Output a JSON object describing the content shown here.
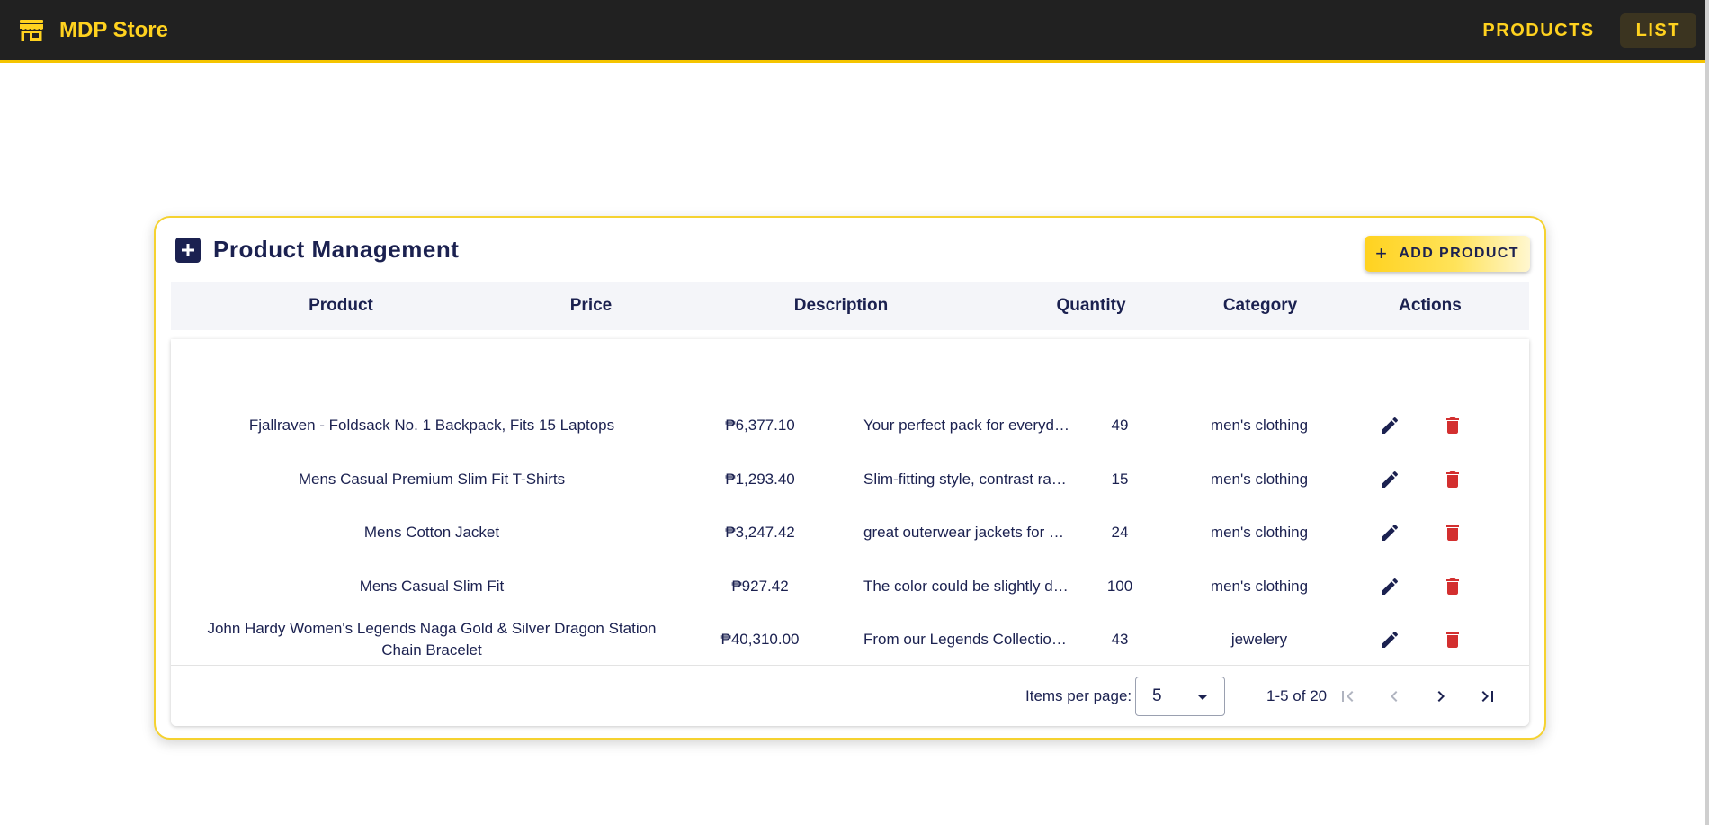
{
  "app": {
    "name": "MDP Store",
    "nav": [
      {
        "label": "PRODUCTS",
        "active": false
      },
      {
        "label": "LIST",
        "active": true
      }
    ]
  },
  "panel": {
    "title": "Product Management",
    "add_button": "ADD PRODUCT"
  },
  "table": {
    "columns": [
      "Product",
      "Price",
      "Description",
      "Quantity",
      "Category",
      "Actions"
    ],
    "rows": [
      {
        "product": "Fjallraven - Foldsack No. 1 Backpack, Fits 15 Laptops",
        "price": "₱6,377.10",
        "description": "Your perfect pack for everyday u...",
        "quantity": "49",
        "category": "men's clothing"
      },
      {
        "product": "Mens Casual Premium Slim Fit T-Shirts",
        "price": "₱1,293.40",
        "description": "Slim-fitting style, contrast raglan...",
        "quantity": "15",
        "category": "men's clothing"
      },
      {
        "product": "Mens Cotton Jacket",
        "price": "₱3,247.42",
        "description": "great outerwear jackets for Spri...",
        "quantity": "24",
        "category": "men's clothing"
      },
      {
        "product": "Mens Casual Slim Fit",
        "price": "₱927.42",
        "description": "The color could be slightly differ...",
        "quantity": "100",
        "category": "men's clothing"
      },
      {
        "product": "John Hardy Women's Legends Naga Gold & Silver Dragon Station Chain Bracelet",
        "price": "₱40,310.00",
        "description": "From our Legends Collection, th...",
        "quantity": "43",
        "category": "jewelery"
      }
    ]
  },
  "paginator": {
    "items_per_page_label": "Items per page:",
    "items_per_page": "5",
    "range": "1-5 of 20"
  },
  "colors": {
    "accent": "#ffd21f",
    "navy": "#1b2150",
    "delete": "#d32f2f",
    "topbar": "#212121"
  },
  "icons": {
    "brand": "storefront-icon",
    "header": "add-box-icon",
    "edit": "pencil-icon",
    "delete": "trash-icon"
  }
}
